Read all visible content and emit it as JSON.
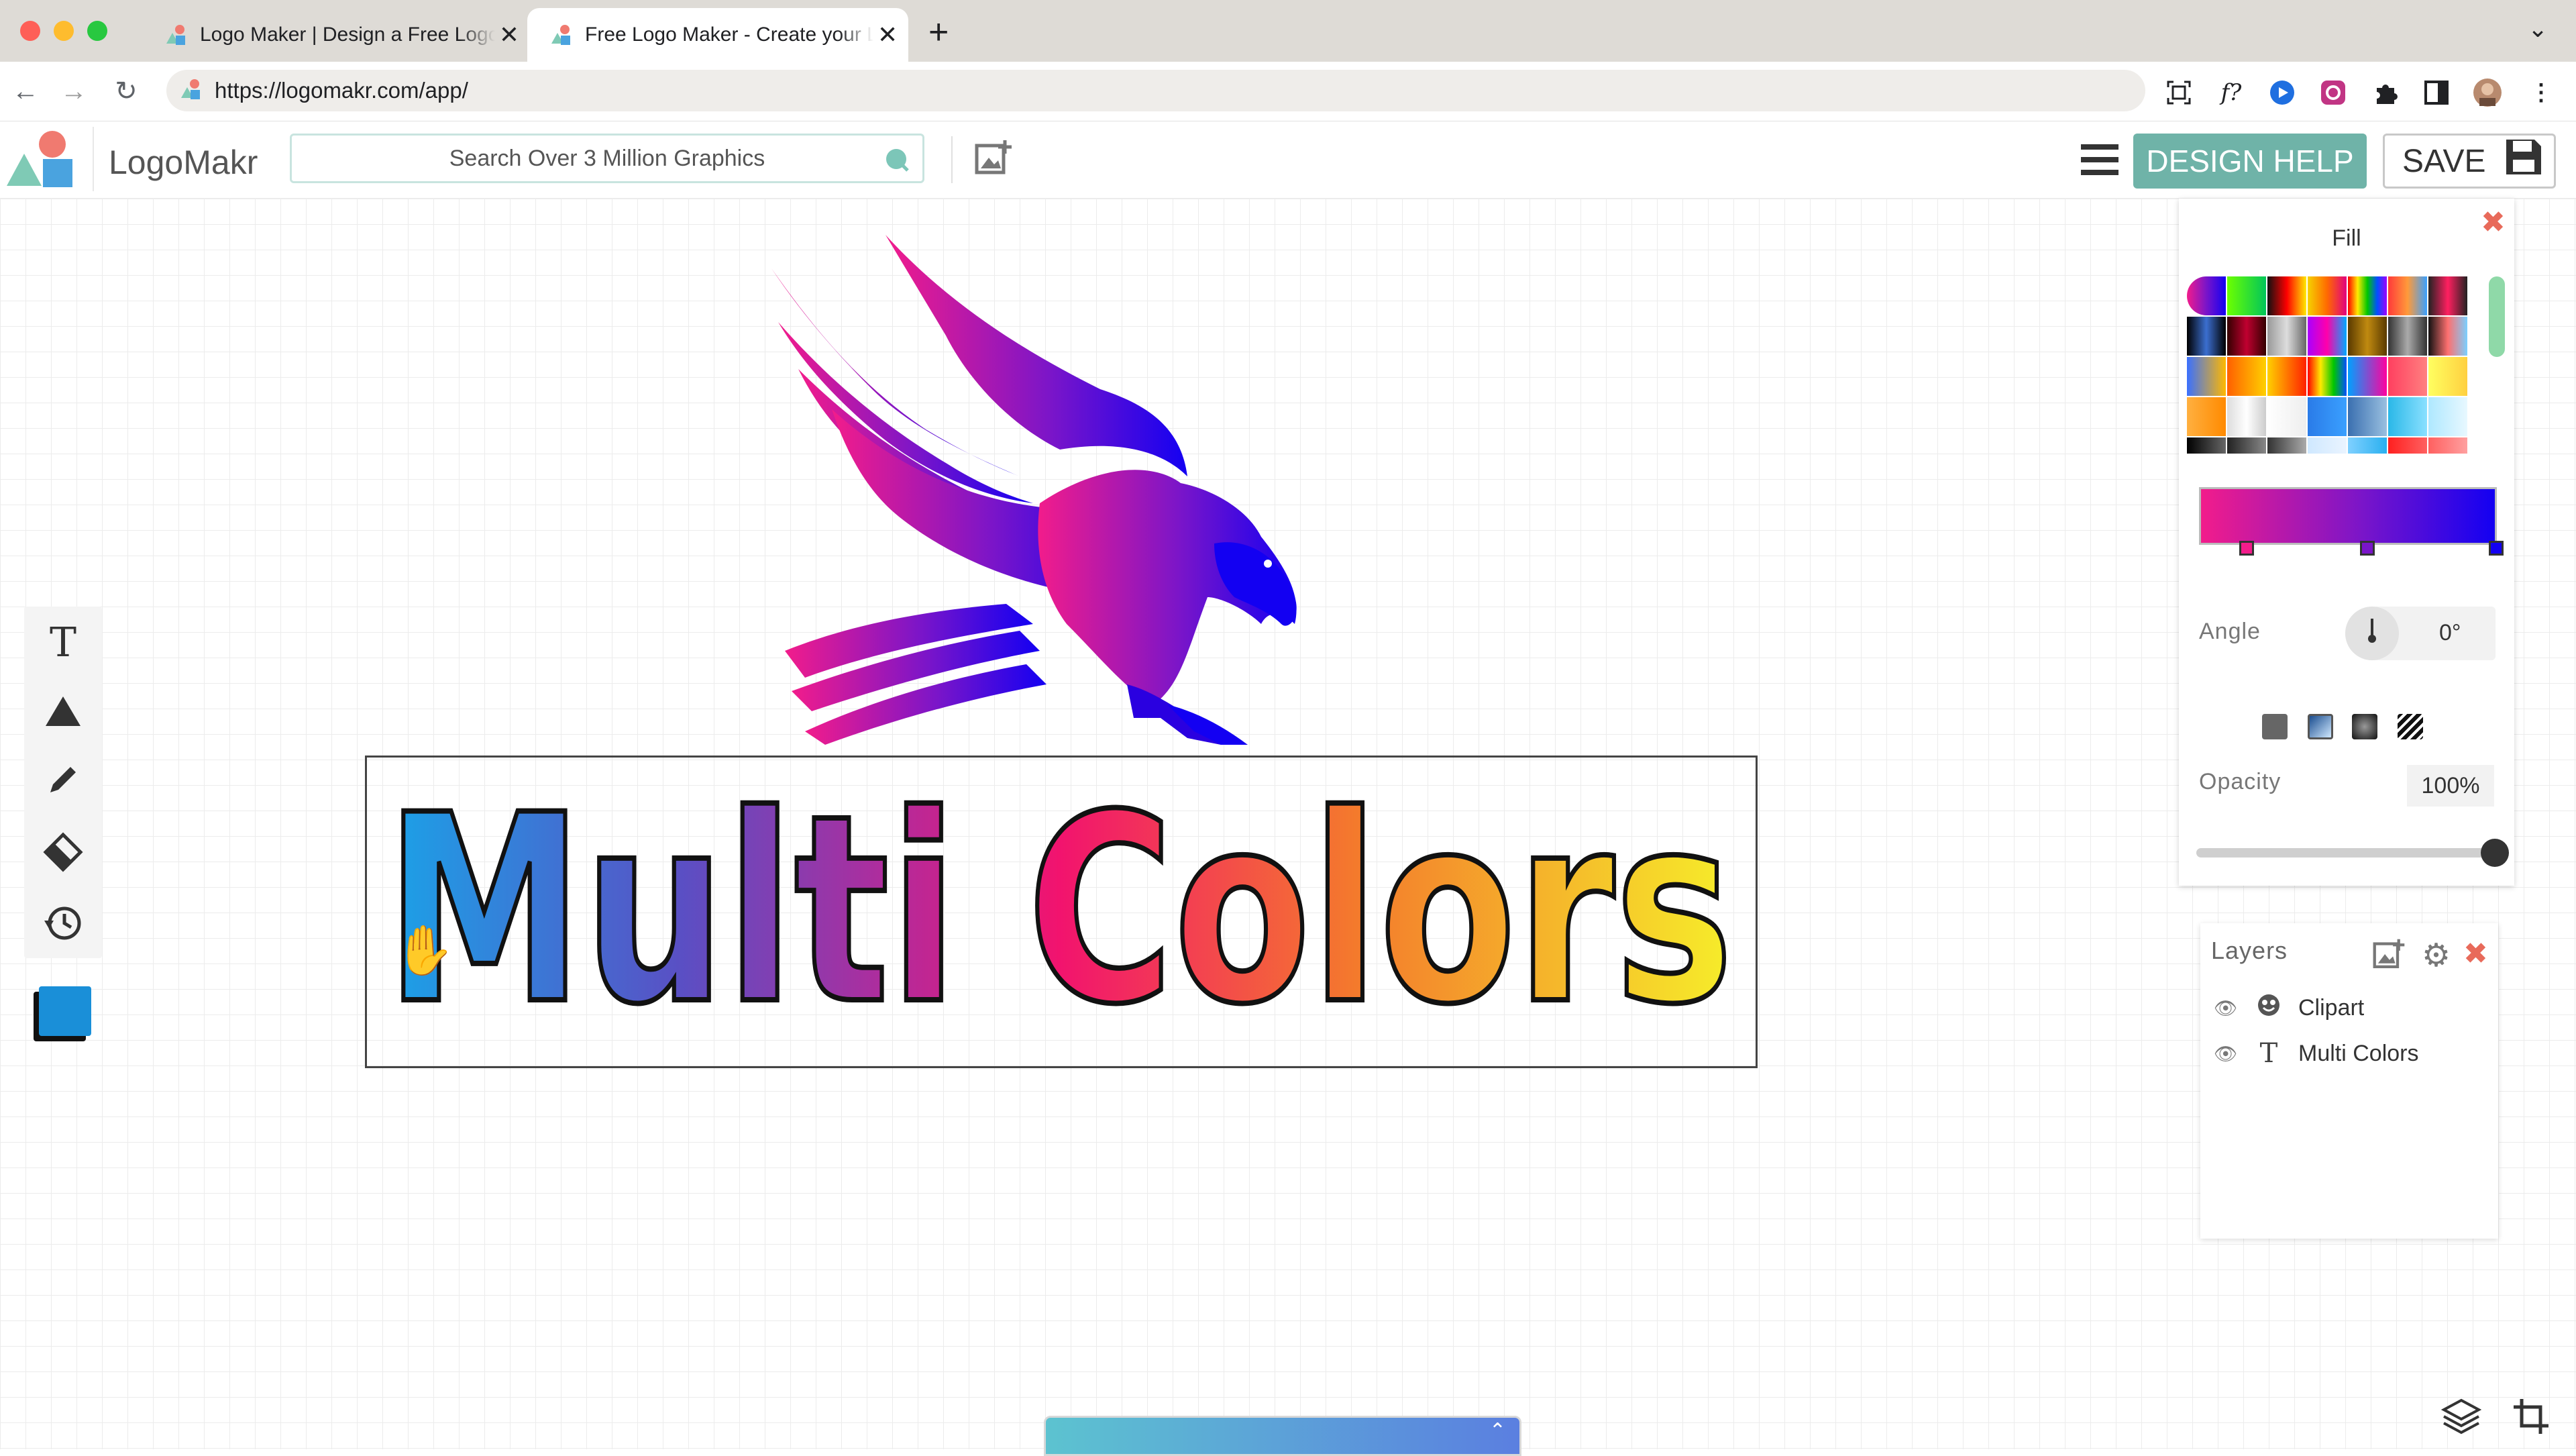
{
  "browser": {
    "tabs": [
      {
        "title": "Logo Maker | Design a Free Logo",
        "active": false
      },
      {
        "title": "Free Logo Maker - Create your Logo",
        "active": true
      }
    ],
    "url": "https://logomakr.com/app/",
    "extension_icons": [
      "screenshot-icon",
      "formula-icon",
      "extension-blue-icon",
      "extension-color-icon",
      "puzzle-icon",
      "sidebar-icon",
      "profile-avatar",
      "more-icon"
    ]
  },
  "app": {
    "brand": "LogoMakr",
    "search_placeholder": "Search Over 3 Million Graphics",
    "design_help": "DESIGN HELP",
    "save": "SAVE"
  },
  "canvas": {
    "text": "Multi Colors",
    "clipart": "eagle",
    "swatch_color": "#1a8fd8"
  },
  "fill_panel": {
    "title": "Fill",
    "gradient_stops": [
      "#f21c8b",
      "#7a15c9",
      "#1300f2"
    ],
    "angle_label": "Angle",
    "angle_value": "0°",
    "opacity_label": "Opacity",
    "opacity_value": "100%",
    "opacity_level": 1.0
  },
  "layers_panel": {
    "title": "Layers",
    "layers": [
      {
        "name": "Clipart",
        "type": "clipart"
      },
      {
        "name": "Multi Colors",
        "type": "text"
      }
    ]
  }
}
